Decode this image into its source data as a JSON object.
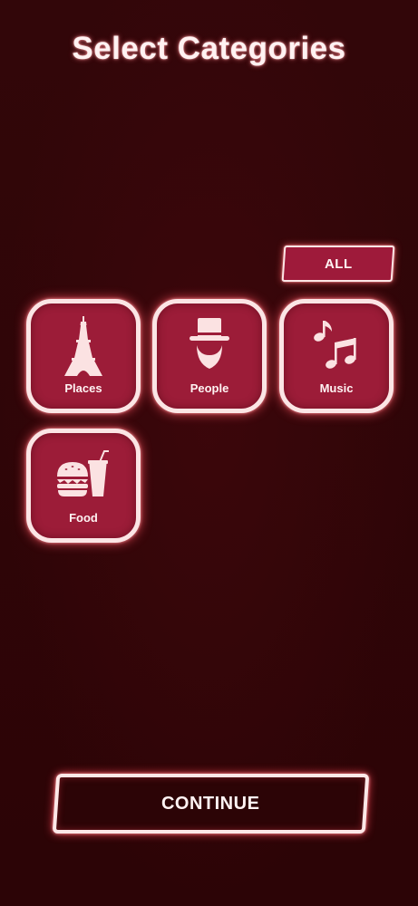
{
  "header": {
    "title": "Select Categories"
  },
  "all_button": {
    "label": "ALL"
  },
  "categories": [
    {
      "label": "Places",
      "icon": "eiffel-tower-icon"
    },
    {
      "label": "People",
      "icon": "top-hat-person-icon"
    },
    {
      "label": "Music",
      "icon": "music-notes-icon"
    },
    {
      "label": "Food",
      "icon": "burger-drink-icon"
    }
  ],
  "continue_button": {
    "label": "CONTINUE"
  },
  "colors": {
    "background": "#2e0507",
    "tile_fill": "#9c1c38",
    "tile_border": "#fbe5e5",
    "glow": "#ff5060",
    "text": "#fff3f3"
  }
}
